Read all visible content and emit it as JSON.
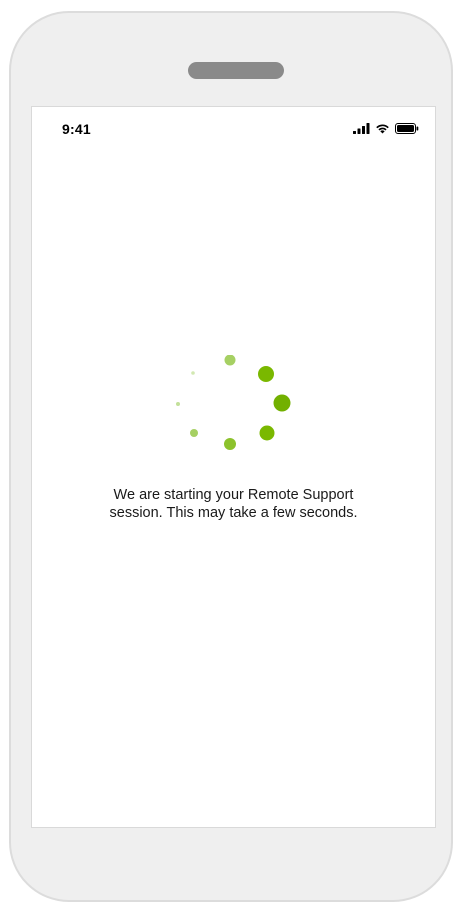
{
  "status_bar": {
    "time": "9:41",
    "signal_icon": "cellular-signal-icon",
    "wifi_icon": "wifi-icon",
    "battery_icon": "battery-icon"
  },
  "loading": {
    "spinner_icon": "loading-spinner-icon",
    "accent_color": "#7ab800"
  },
  "message": {
    "line1": "We are starting your Remote Support",
    "line2": "session. This may take a few seconds."
  }
}
